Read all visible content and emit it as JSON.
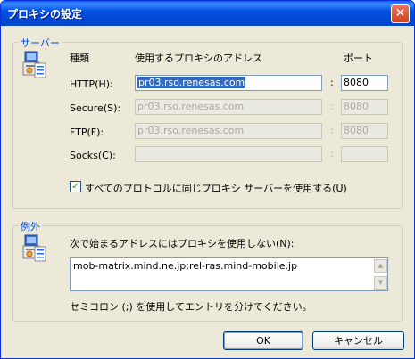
{
  "window": {
    "title": "プロキシの設定",
    "close_glyph": "✕"
  },
  "servers": {
    "group_title": "サーバー",
    "col_type": "種類",
    "col_address": "使用するプロキシのアドレス",
    "col_port": "ポート",
    "rows": [
      {
        "label": "HTTP(H):",
        "address": "pr03.rso.renesas.com",
        "port": "8080",
        "enabled": true
      },
      {
        "label": "Secure(S):",
        "address": "pr03.rso.renesas.com",
        "port": "8080",
        "enabled": false
      },
      {
        "label": "FTP(F):",
        "address": "pr03.rso.renesas.com",
        "port": "8080",
        "enabled": false
      },
      {
        "label": "Socks(C):",
        "address": "",
        "port": "",
        "enabled": false
      }
    ],
    "separator": ":",
    "same_proxy_label": "すべてのプロトコルに同じプロキシ サーバーを使用する(U)",
    "same_proxy_checked": true
  },
  "exceptions": {
    "group_title": "例外",
    "instruction": "次で始まるアドレスにはプロキシを使用しない(N):",
    "list_value": "mob-matrix.mind.ne.jp;rel-ras.mind-mobile.jp",
    "note": "セミコロン (;) を使用してエントリを分けてください。"
  },
  "buttons": {
    "ok": "OK",
    "cancel": "キャンセル"
  }
}
